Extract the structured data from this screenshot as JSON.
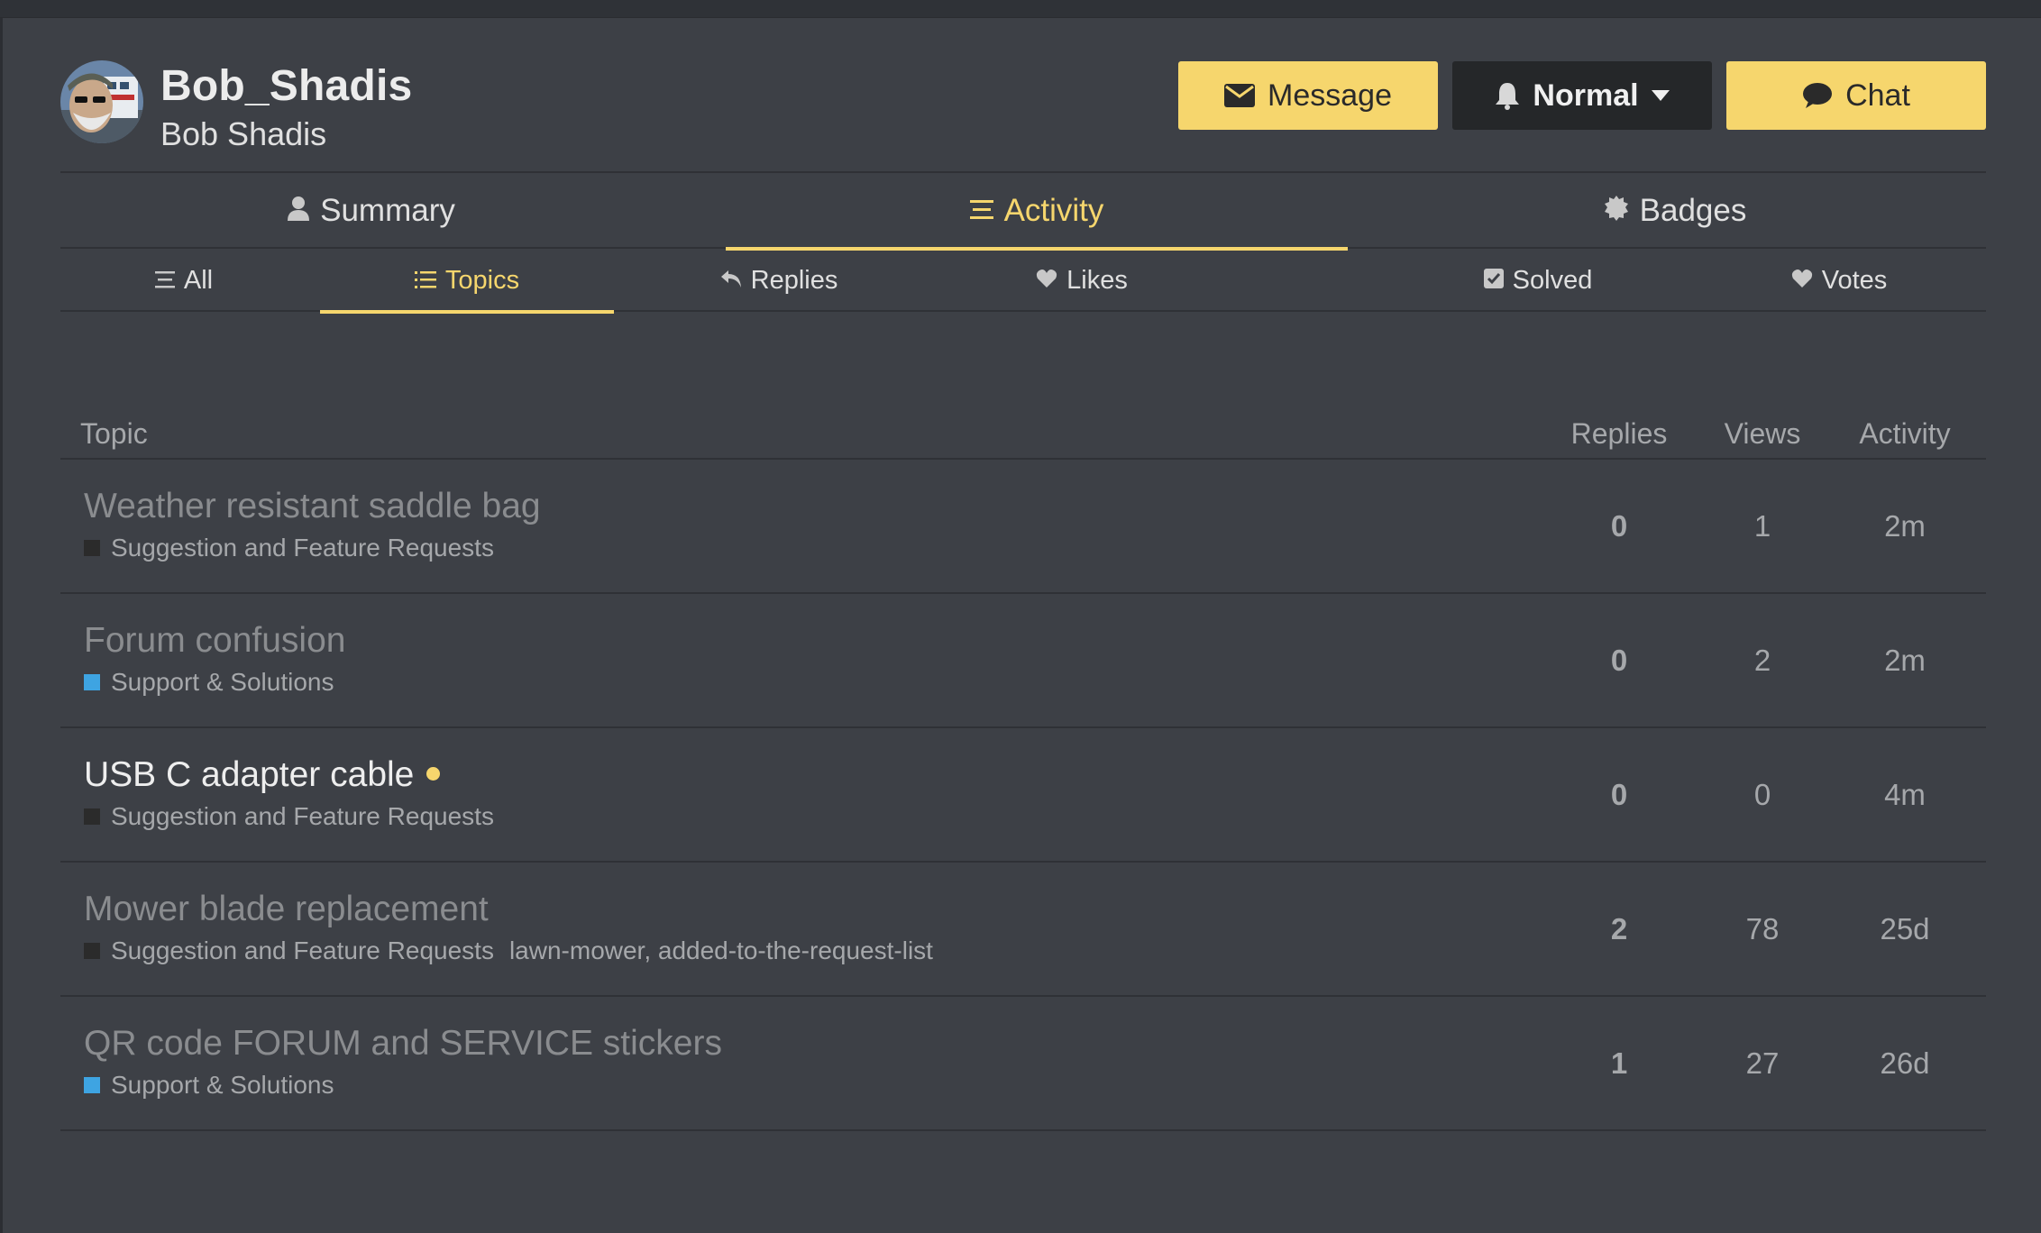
{
  "profile": {
    "username": "Bob_Shadis",
    "full_name": "Bob Shadis"
  },
  "actions": {
    "message_label": "Message",
    "notification_label": "Normal",
    "chat_label": "Chat"
  },
  "primary_tabs": [
    {
      "label": "Summary",
      "icon": "user-icon"
    },
    {
      "label": "Activity",
      "icon": "stream-icon",
      "active": true
    },
    {
      "label": "Badges",
      "icon": "certificate-icon"
    }
  ],
  "secondary_tabs": [
    {
      "label": "All",
      "icon": "stream-icon"
    },
    {
      "label": "Topics",
      "icon": "list-icon",
      "active": true
    },
    {
      "label": "Replies",
      "icon": "reply-icon"
    },
    {
      "label": "Likes",
      "icon": "heart-icon"
    },
    {
      "label": "Solved",
      "icon": "check-square-icon"
    },
    {
      "label": "Votes",
      "icon": "heart-icon"
    }
  ],
  "table": {
    "headers": {
      "topic": "Topic",
      "replies": "Replies",
      "views": "Views",
      "activity": "Activity"
    },
    "rows": [
      {
        "title": "Weather resistant saddle bag",
        "category": "Suggestion and Feature Requests",
        "category_color": "#2b2b2b",
        "tags": "",
        "replies": "0",
        "views": "1",
        "activity": "2m",
        "unread": false
      },
      {
        "title": "Forum confusion",
        "category": "Support & Solutions",
        "category_color": "#3ea4e2",
        "tags": "",
        "replies": "0",
        "views": "2",
        "activity": "2m",
        "unread": false
      },
      {
        "title": "USB C adapter cable",
        "category": "Suggestion and Feature Requests",
        "category_color": "#2b2b2b",
        "tags": "",
        "replies": "0",
        "views": "0",
        "activity": "4m",
        "unread": true
      },
      {
        "title": "Mower blade replacement",
        "category": "Suggestion and Feature Requests",
        "category_color": "#2b2b2b",
        "tags": "lawn-mower, added-to-the-request-list",
        "replies": "2",
        "views": "78",
        "activity": "25d",
        "unread": false
      },
      {
        "title": "QR code FORUM and SERVICE stickers",
        "category": "Support & Solutions",
        "category_color": "#3ea4e2",
        "tags": "",
        "replies": "1",
        "views": "27",
        "activity": "26d",
        "unread": false
      }
    ]
  },
  "colors": {
    "accent": "#f6d66d",
    "background": "#3d4046",
    "dark_button": "#252729"
  }
}
